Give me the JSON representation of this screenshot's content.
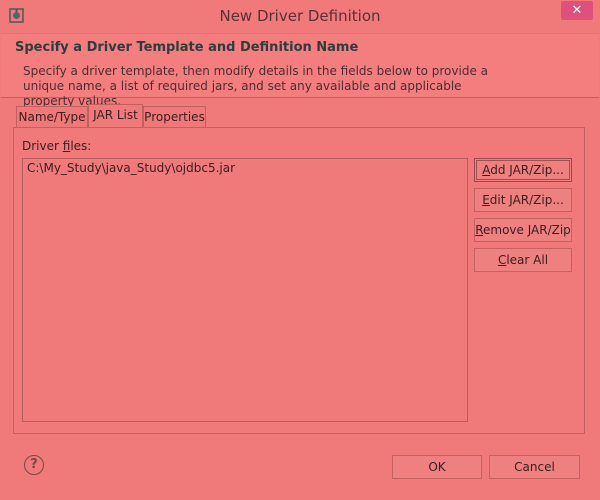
{
  "window": {
    "title": "New Driver Definition",
    "close_symbol": "✕"
  },
  "header": {
    "title": "Specify a Driver Template and Definition Name",
    "description": "Specify a driver template, then modify details in the fields below to provide a unique name, a list of required jars, and set any available and applicable property values."
  },
  "tabs": [
    {
      "label": "Name/Type",
      "active": false
    },
    {
      "label": "JAR List",
      "active": true
    },
    {
      "label": "Properties",
      "active": false
    }
  ],
  "jar_list": {
    "driver_files_label_prefix": "Driver ",
    "driver_files_label_mnemonic": "f",
    "driver_files_label_suffix": "iles:",
    "files": [
      "C:\\My_Study\\java_Study\\ojdbc5.jar"
    ]
  },
  "buttons": {
    "add": {
      "mnemonic": "A",
      "rest": "dd JAR/Zip..."
    },
    "edit": {
      "mnemonic": "E",
      "rest": "dit JAR/Zip..."
    },
    "remove": {
      "mnemonic": "R",
      "rest": "emove JAR/Zip"
    },
    "clear": {
      "mnemonic": "C",
      "rest": "lear All"
    }
  },
  "footer": {
    "help_symbol": "?",
    "ok_label": "OK",
    "cancel_label": "Cancel"
  },
  "colors": {
    "background": "#f07a7a",
    "close_button": "#e0507c",
    "header_title": "#2a3e3e"
  }
}
